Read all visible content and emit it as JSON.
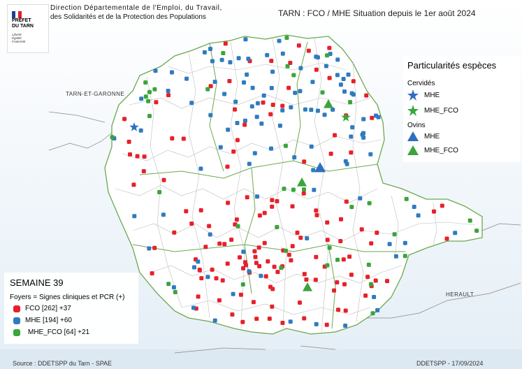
{
  "header": {
    "logo_title_line1": "PRÉFET",
    "logo_title_line2": "DU TARN",
    "logo_motto_1": "Liberté",
    "logo_motto_2": "Égalité",
    "logo_motto_3": "Fraternité",
    "direction_line1": "Direction Départementale de l'Emploi, du Travail,",
    "direction_line2": "des Solidarités et de la Protection des Populations",
    "map_title": "TARN : FCO / MHE Situation depuis le 1er août 2024"
  },
  "places": {
    "tarn_et_garonne": "TARN-ET-GARONNE",
    "herault": "HERAULT"
  },
  "legend_species": {
    "title": "Particularités espèces",
    "cervides": "Cervidés",
    "cervides_mhe": "MHE",
    "cervides_mhe_fco": "MHE_FCO",
    "ovins": "Ovins",
    "ovins_mhe": "MHE",
    "ovins_mhe_fco": "MHE_FCO"
  },
  "legend_foyers": {
    "week": "SEMAINE 39",
    "subtitle": "Foyers =  Signes cliniques et PCR (+)",
    "fco": "FCO [262] +37",
    "mhe": "MHE [194] +60",
    "mhe_fco": "MHE_FCO [64] +21"
  },
  "footer": {
    "source": "Source : DDETSPP du Tarn - SPAE",
    "credit": "DDETSPP - 17/09/2024"
  },
  "colors": {
    "fco": "#e8202a",
    "mhe": "#2f7bc0",
    "mhe_fco": "#3aa53a",
    "blue_star": "#2f6fbf",
    "green_symbol": "#3aa53a"
  }
}
